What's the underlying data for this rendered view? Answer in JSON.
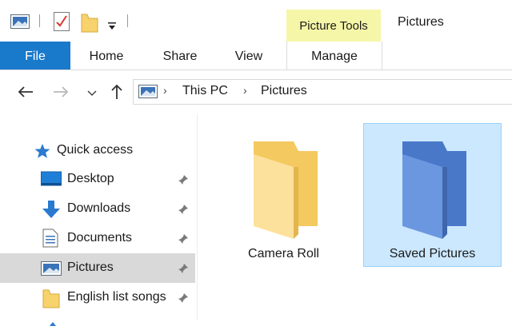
{
  "title_bar": {
    "context_tab_group": "Picture Tools",
    "window_title": "Pictures"
  },
  "ribbon": {
    "tabs": [
      {
        "label": "File",
        "active": true
      },
      {
        "label": "Home"
      },
      {
        "label": "Share"
      },
      {
        "label": "View"
      },
      {
        "label": "Manage"
      }
    ]
  },
  "address_bar": {
    "path": [
      "This PC",
      "Pictures"
    ]
  },
  "nav_pane": {
    "quick_access_label": "Quick access",
    "items": [
      {
        "label": "Desktop",
        "icon": "desktop-icon",
        "pinned": true
      },
      {
        "label": "Downloads",
        "icon": "download-arrow-icon",
        "pinned": true
      },
      {
        "label": "Documents",
        "icon": "document-icon",
        "pinned": true
      },
      {
        "label": "Pictures",
        "icon": "pictures-icon",
        "pinned": true,
        "selected": true
      },
      {
        "label": "English list songs",
        "icon": "folder-icon",
        "pinned": true
      }
    ]
  },
  "content": {
    "items": [
      {
        "label": "Camera Roll",
        "selected": false
      },
      {
        "label": "Saved Pictures",
        "selected": true
      }
    ]
  },
  "colors": {
    "file_tab": "#1979ca",
    "context_header": "#f6f6a8",
    "selection_fill": "#cce8ff",
    "selection_border": "#99d1ff",
    "nav_selected": "#d9d9d9"
  }
}
